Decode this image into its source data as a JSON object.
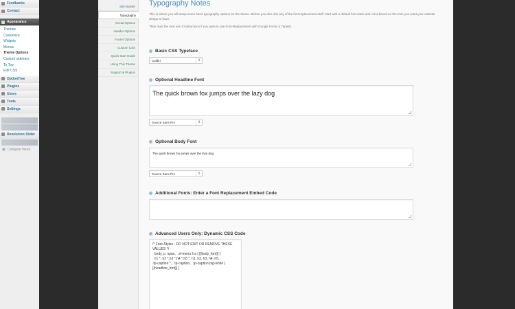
{
  "wp_menu": {
    "top_items": [
      {
        "label": "Feedbacks"
      },
      {
        "label": "Contact"
      }
    ],
    "appearance": {
      "label": "Appearance"
    },
    "appearance_submenu": [
      "Themes",
      "Customize",
      "Widgets",
      "Menus",
      "Theme Options",
      "Custom sidebars",
      "To Top",
      "Edit CSS"
    ],
    "current_submenu": "Theme Options",
    "after_items": [
      {
        "label": "OptionTree"
      },
      {
        "label": "Plugins"
      },
      {
        "label": "Users"
      },
      {
        "label": "Tools"
      },
      {
        "label": "Settings"
      }
    ],
    "revolution": {
      "label": "Revolution Slider"
    },
    "collapse": "Collapse menu"
  },
  "tabs": [
    {
      "label": "Site Builder",
      "style": "blue"
    },
    {
      "label": "Typography",
      "style": "active"
    },
    {
      "label": "Social Options",
      "style": "green"
    },
    {
      "label": "Header Options",
      "style": "green"
    },
    {
      "label": "Footer Options",
      "style": "green"
    },
    {
      "label": "Custom CSS",
      "style": "green"
    },
    {
      "label": "Quick Start Guide",
      "style": "green"
    },
    {
      "label": "Using This Theme",
      "style": "green"
    },
    {
      "label": "Support & Plugins",
      "style": "green"
    }
  ],
  "main": {
    "title": "Typography Notes",
    "intro": "This is where you will setup some basic typography options for the theme. Before you dive into any of the font-replacement stuff, start with a default font-stack and color based on the tone you want your website design to have.",
    "intro2": "Then read the next set of instructions if you want to use Font-Replacement with Google Fonts or Typekit.",
    "basic_typeface": {
      "heading": "Basic CSS Typeface",
      "value": "Calibri"
    },
    "headline_font": {
      "heading": "Optional Headline Font",
      "preview": "The quick brown fox jumps over the lazy dog",
      "font": "Source Sans Pro"
    },
    "body_font": {
      "heading": "Optional Body Font",
      "preview": "The quick brown fox jumps over the lazy dog",
      "font": "Source Sans Pro"
    },
    "additional_fonts": {
      "heading": "Additional Fonts: Enter a Font Replacement Embed Code",
      "value": ""
    },
    "dynamic_css": {
      "heading": "Advanced Users Only: Dynamic CSS Code",
      "value": "/* Font-Styles - DO NOT EDIT OR REMOVE THESE VALUES */\n  body, p, span,  .sf-menu li a { [{body_font}] }\n  h1 *, h2 *,h3 *,h4 *,h5 *, h1, h2, h3, h4, h5,\n.tp-caption *,  .tp-caption,  .tp-caption.big-white {\n[{headline_font}] }"
    }
  }
}
